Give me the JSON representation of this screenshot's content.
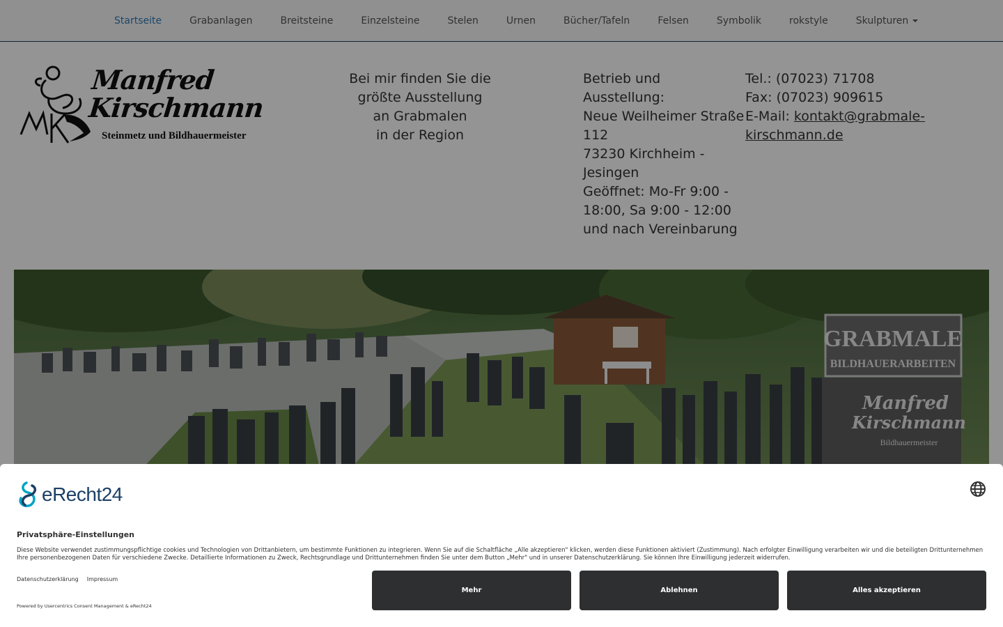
{
  "nav": {
    "items": [
      {
        "label": "Startseite",
        "active": true
      },
      {
        "label": "Grabanlagen"
      },
      {
        "label": "Breitsteine"
      },
      {
        "label": "Einzelsteine"
      },
      {
        "label": "Stelen"
      },
      {
        "label": "Urnen"
      },
      {
        "label": "Bücher/Tafeln"
      },
      {
        "label": "Felsen"
      },
      {
        "label": "Symbolik"
      },
      {
        "label": "rokstyle"
      },
      {
        "label": "Skulpturen",
        "dropdown": true
      }
    ]
  },
  "header": {
    "logo": {
      "name_line1": "Manfred",
      "name_line2": "Kirschmann",
      "subtitle": "Steinmetz und Bildhauermeister",
      "monogram": "MK"
    },
    "tagline": [
      "Bei mir finden Sie die",
      "größte Ausstellung",
      "an Grabmalen",
      "in der Region"
    ],
    "address": [
      "Betrieb und Ausstellung:",
      "Neue Weilheimer Straße",
      "112",
      "73230 Kirchheim -",
      "Jesingen",
      "Geöffnet: Mo-Fr 9:00 -",
      "18:00, Sa 9:00 - 12:00",
      "und nach Vereinbarung"
    ],
    "contact": {
      "tel": "Tel.: (07023) 71708",
      "fax": "Fax: (07023) 909615",
      "email_label": "E-Mail: ",
      "email_part1": "kontakt@grabmale-",
      "email_part2": "kirschmann.de"
    }
  },
  "hero": {
    "sign_title": "GRABMALE",
    "sign_subtitle": "BILDHAUERARBEITEN",
    "sign_name1": "Manfred",
    "sign_name2": "Kirschmann",
    "sign_role": "Bildhauermeister"
  },
  "consent": {
    "brand": "eRecht24",
    "title": "Privatsphäre-Einstellungen",
    "text": "Diese Website verwendet zustimmungspflichtige cookies und Technologien von Drittanbietern, um bestimmte Funktionen zu integrieren. Wenn Sie auf die Schaltfläche „Alle akzeptieren\" klicken, werden diese Funktionen aktiviert (Zustimmung). Nach erfolgter Einwilligung verarbeiten wir und die beteiligten Drittunternehmen Ihre personenbezogenen Daten für verschiedene Zwecke. Detaillierte Informationen zu Zweck, Rechtsgrundlage und Drittunternehmen finden Sie unter dem Button „Mehr\" und in unserer Datenschutzerklärung. Sie können Ihre Einwilligung jederzeit widerrufen.",
    "link_privacy": "Datenschutzerklärung",
    "link_imprint": "Impressum",
    "powered": "Powered by Usercentrics Consent Management & eRecht24",
    "btn_more": "Mehr",
    "btn_decline": "Ablehnen",
    "btn_accept": "Alles akzeptieren"
  },
  "colors": {
    "nav_active": "#337ab7",
    "button_bg": "#2d2f31",
    "brand_blue": "#1b3f66",
    "brand_cyan": "#00a3c4"
  }
}
